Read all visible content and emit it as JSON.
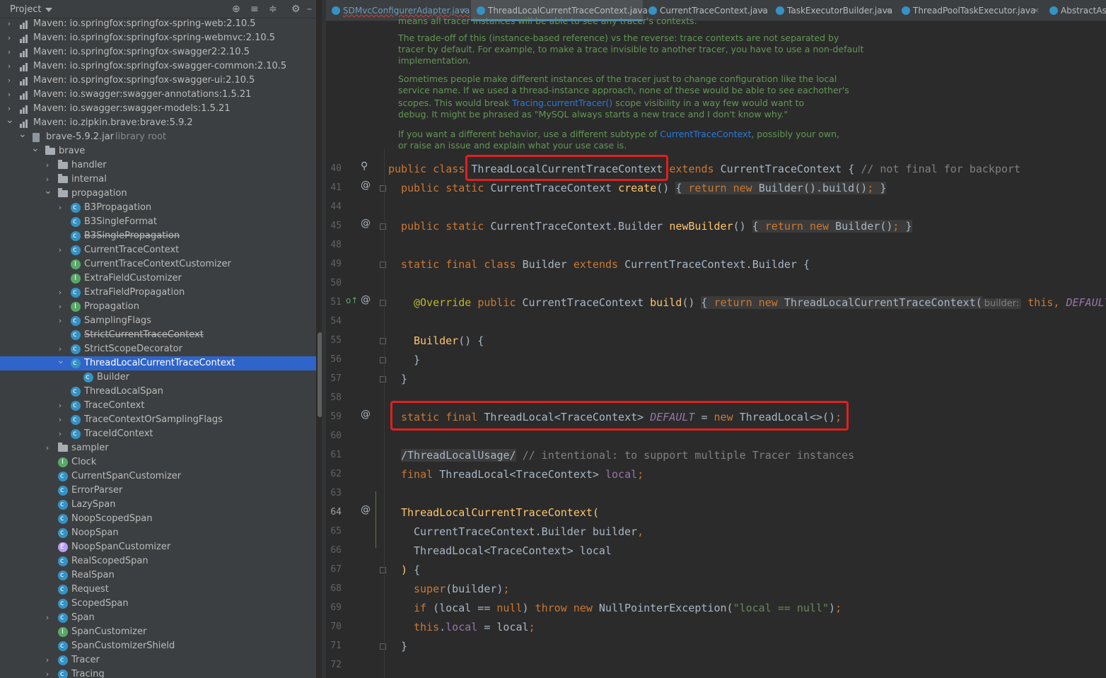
{
  "project": {
    "title": "Project",
    "tree": [
      {
        "label": "Maven: io.springfox:springfox-spring-web:2.10.5",
        "icon": "maven-icon",
        "indent": 0,
        "arrow": ">"
      },
      {
        "label": "Maven: io.springfox:springfox-spring-webmvc:2.10.5",
        "icon": "maven-icon",
        "indent": 0,
        "arrow": ">"
      },
      {
        "label": "Maven: io.springfox:springfox-swagger2:2.10.5",
        "icon": "maven-icon",
        "indent": 0,
        "arrow": ">"
      },
      {
        "label": "Maven: io.springfox:springfox-swagger-common:2.10.5",
        "icon": "maven-icon",
        "indent": 0,
        "arrow": ">"
      },
      {
        "label": "Maven: io.springfox:springfox-swagger-ui:2.10.5",
        "icon": "maven-icon",
        "indent": 0,
        "arrow": ">"
      },
      {
        "label": "Maven: io.swagger:swagger-annotations:1.5.21",
        "icon": "maven-icon",
        "indent": 0,
        "arrow": ">"
      },
      {
        "label": "Maven: io.swagger:swagger-models:1.5.21",
        "icon": "maven-icon",
        "indent": 0,
        "arrow": ">"
      },
      {
        "label": "Maven: io.zipkin.brave:brave:5.9.2",
        "icon": "maven-icon",
        "indent": 0,
        "arrow": "v"
      },
      {
        "label": "brave-5.9.2.jar",
        "suffix": "library root",
        "icon": "jar-icon",
        "indent": 1,
        "arrow": "v"
      },
      {
        "label": "brave",
        "icon": "folder-icon",
        "indent": 2,
        "arrow": "v"
      },
      {
        "label": "handler",
        "icon": "folder-icon",
        "indent": 3,
        "arrow": ">"
      },
      {
        "label": "internal",
        "icon": "folder-icon",
        "indent": 3,
        "arrow": ">"
      },
      {
        "label": "propagation",
        "icon": "folder-icon",
        "indent": 3,
        "arrow": "v"
      },
      {
        "label": "B3Propagation",
        "icon": "class-icon",
        "indent": 4,
        "arrow": ">"
      },
      {
        "label": "B3SingleFormat",
        "icon": "class-icon",
        "indent": 4,
        "arrow": ""
      },
      {
        "label": "B3SinglePropagation",
        "icon": "class-icon",
        "indent": 4,
        "arrow": "",
        "strike": true
      },
      {
        "label": "CurrentTraceContext",
        "icon": "class-icon",
        "indent": 4,
        "arrow": ">"
      },
      {
        "label": "CurrentTraceContextCustomizer",
        "icon": "interface-icon",
        "indent": 4,
        "arrow": ""
      },
      {
        "label": "ExtraFieldCustomizer",
        "icon": "interface-icon",
        "indent": 4,
        "arrow": ""
      },
      {
        "label": "ExtraFieldPropagation",
        "icon": "class-icon",
        "indent": 4,
        "arrow": ">"
      },
      {
        "label": "Propagation",
        "icon": "interface-icon",
        "indent": 4,
        "arrow": ">"
      },
      {
        "label": "SamplingFlags",
        "icon": "class-icon",
        "indent": 4,
        "arrow": ">"
      },
      {
        "label": "StrictCurrentTraceContext",
        "icon": "class-icon",
        "indent": 4,
        "arrow": "",
        "strike": true
      },
      {
        "label": "StrictScopeDecorator",
        "icon": "class-icon",
        "indent": 4,
        "arrow": ">"
      },
      {
        "label": "ThreadLocalCurrentTraceContext",
        "icon": "class-icon",
        "indent": 4,
        "arrow": "v",
        "selected": true
      },
      {
        "label": "Builder",
        "icon": "class-icon",
        "indent": 5,
        "arrow": ""
      },
      {
        "label": "ThreadLocalSpan",
        "icon": "class-icon",
        "indent": 4,
        "arrow": ""
      },
      {
        "label": "TraceContext",
        "icon": "class-icon",
        "indent": 4,
        "arrow": ">"
      },
      {
        "label": "TraceContextOrSamplingFlags",
        "icon": "class-icon",
        "indent": 4,
        "arrow": ">"
      },
      {
        "label": "TraceIdContext",
        "icon": "class-icon",
        "indent": 4,
        "arrow": ">"
      },
      {
        "label": "sampler",
        "icon": "folder-icon",
        "indent": 3,
        "arrow": ">"
      },
      {
        "label": "Clock",
        "icon": "interface-icon",
        "indent": 3,
        "arrow": ""
      },
      {
        "label": "CurrentSpanCustomizer",
        "icon": "class-icon",
        "indent": 3,
        "arrow": ""
      },
      {
        "label": "ErrorParser",
        "icon": "class-icon",
        "indent": 3,
        "arrow": ""
      },
      {
        "label": "LazySpan",
        "icon": "class-icon",
        "indent": 3,
        "arrow": ""
      },
      {
        "label": "NoopScopedSpan",
        "icon": "class-icon",
        "indent": 3,
        "arrow": ""
      },
      {
        "label": "NoopSpan",
        "icon": "class-icon",
        "indent": 3,
        "arrow": ""
      },
      {
        "label": "NoopSpanCustomizer",
        "icon": "enum-icon",
        "indent": 3,
        "arrow": ""
      },
      {
        "label": "RealScopedSpan",
        "icon": "class-icon",
        "indent": 3,
        "arrow": ""
      },
      {
        "label": "RealSpan",
        "icon": "class-icon",
        "indent": 3,
        "arrow": ""
      },
      {
        "label": "Request",
        "icon": "class-icon",
        "indent": 3,
        "arrow": ""
      },
      {
        "label": "ScopedSpan",
        "icon": "class-icon",
        "indent": 3,
        "arrow": ""
      },
      {
        "label": "Span",
        "icon": "class-icon",
        "indent": 3,
        "arrow": ">"
      },
      {
        "label": "SpanCustomizer",
        "icon": "interface-icon",
        "indent": 3,
        "arrow": ""
      },
      {
        "label": "SpanCustomizerShield",
        "icon": "class-icon",
        "indent": 3,
        "arrow": ""
      },
      {
        "label": "Tracer",
        "icon": "class-icon",
        "indent": 3,
        "arrow": ">"
      },
      {
        "label": "Tracing",
        "icon": "class-icon",
        "indent": 3,
        "arrow": ">"
      }
    ]
  },
  "tabs": [
    {
      "label": "SDMvcConfigurerAdapter.java",
      "active": false,
      "error": true
    },
    {
      "label": "ThreadLocalCurrentTraceContext.java",
      "active": true
    },
    {
      "label": "CurrentTraceContext.java",
      "active": false
    },
    {
      "label": "TaskExecutorBuilder.java",
      "active": false
    },
    {
      "label": "ThreadPoolTaskExecutor.java",
      "active": false
    },
    {
      "label": "AbstractAsyn",
      "active": false
    }
  ],
  "doc": {
    "p0": "means all tracer instances will be able to see any tracer's contexts.",
    "p1a": "The trade-off of this (instance-based reference) vs the reverse: trace contexts are not separated by",
    "p1b": "tracer by default. For example, to make a trace invisible to another tracer, you have to use a non-default",
    "p1c": "implementation.",
    "p2a": "Sometimes people make different instances of the tracer just to change configuration like the local",
    "p2b": "service name. If we used a thread-instance approach, none of these would be able to see eachother's",
    "p2c_pre": "scopes. This would break ",
    "p2c_link": "Tracing.currentTracer()",
    "p2c_post": " scope visibility in a way few would want to",
    "p2d": "debug. It might be phrased as \"MySQL always starts a new trace and I don't know why.\"",
    "p3a_pre": "If you want a different behavior, use a different subtype of ",
    "p3a_link": "CurrentTraceContext",
    "p3a_post": ", possibly your own,",
    "p3b": "or raise an issue and explain what your use case is."
  },
  "code": {
    "line_numbers": [
      "40",
      "41",
      "44",
      "45",
      "48",
      "49",
      "50",
      "51",
      "54",
      "55",
      "56",
      "57",
      "58",
      "59",
      "60",
      "61",
      "62",
      "63",
      "64",
      "65",
      "66",
      "67",
      "68",
      "69",
      "70",
      "71",
      "72"
    ],
    "l40_kw": "public class ",
    "l40_cls": "ThreadLocalCurrentTraceContext",
    "l40_ext": " extends ",
    "l40_base": "CurrentTraceContext { ",
    "l40_cm": "// not final for backport",
    "l41_kw": "public static ",
    "l41_type": "CurrentTraceContext ",
    "l41_fn": "create",
    "l41_rest": "() ",
    "l41_body_kw": "return new ",
    "l41_body": "Builder().build()",
    "l45_kw": "public static ",
    "l45_type": "CurrentTraceContext.Builder ",
    "l45_fn": "newBuilder",
    "l45_rest": "() ",
    "l45_body_kw": "return new ",
    "l45_body": "Builder()",
    "l49_kw": "static final class ",
    "l49_cls": "Builder ",
    "l49_ext": "extends ",
    "l49_base": "CurrentTraceContext.Builder {",
    "l51_ann": "@Override ",
    "l51_kw": "public ",
    "l51_type": "CurrentTraceContext ",
    "l51_fn": "build",
    "l51_rest": "() ",
    "l51_body_kw": "return new ",
    "l51_body": "ThreadLocalCurrentTraceContext(",
    "l51_hint": "builder:",
    "l51_this": " this, ",
    "l51_const": "DEFAULT",
    "l55_fn": "Builder",
    "l55_rest": "() {",
    "l56": "}",
    "l57": "}",
    "l59_kw": "static final ",
    "l59_type": "ThreadLocal<TraceContext> ",
    "l59_const": "DEFAULT",
    "l59_eq": " = ",
    "l59_new": "new ",
    "l59_rest": "ThreadLocal<>()",
    "l61_tag": "/ThreadLocalUsage/",
    "l61_cm": " // intentional: to support multiple Tracer instances",
    "l62_kw": "final ",
    "l62_type": "ThreadLocal<TraceContext> ",
    "l62_fld": "local",
    "l64_fn": "ThreadLocalCurrentTraceContext",
    "l64_paren": "(",
    "l65": "CurrentTraceContext.Builder builder",
    "l66": "ThreadLocal<TraceContext> local",
    "l67_paren": ")",
    "l67_rest": " {",
    "l68_kw": "super",
    "l68_rest": "(builder)",
    "l69_kw": "if ",
    "l69_a": "(local == ",
    "l69_null": "null",
    "l69_b": ") ",
    "l69_throw": "throw new ",
    "l69_c": "NullPointerException(",
    "l69_str": "\"local == null\"",
    "l69_d": ")",
    "l70_kw": "this",
    "l70_dot": ".",
    "l70_fld": "local",
    "l70_rest": " = local",
    "l71": "}"
  },
  "colors": {
    "highlight_box": "#e0201c",
    "selection": "#2f65ca"
  }
}
